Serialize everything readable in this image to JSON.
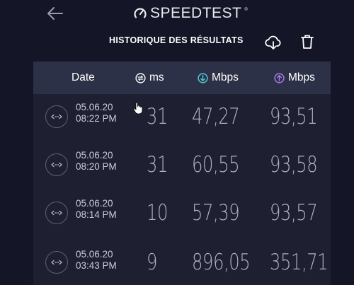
{
  "header": {
    "logo_text": "SPEEDTEST",
    "logo_tm": "®"
  },
  "section": {
    "title": "HISTORIQUE DES RÉSULTATS"
  },
  "table": {
    "columns": {
      "date": "Date",
      "ping": "ms",
      "download": "Mbps",
      "upload": "Mbps"
    },
    "rows": [
      {
        "date": "05.06.20",
        "time": "08:22 PM",
        "ping": "31",
        "download": "47,27",
        "upload": "93,51"
      },
      {
        "date": "05.06.20",
        "time": "08:20 PM",
        "ping": "31",
        "download": "60,55",
        "upload": "93,58"
      },
      {
        "date": "05.06.20",
        "time": "08:14 PM",
        "ping": "10",
        "download": "57,39",
        "upload": "93,57"
      },
      {
        "date": "05.06.20",
        "time": "03:43 PM",
        "ping": "9",
        "download": "896,05",
        "upload": "351,71"
      }
    ]
  },
  "colors": {
    "background": "#141526",
    "table_bg": "#1e2032",
    "header_bg": "#2d3147",
    "download_accent": "#4fd1d9",
    "upload_accent": "#a97ef0"
  }
}
